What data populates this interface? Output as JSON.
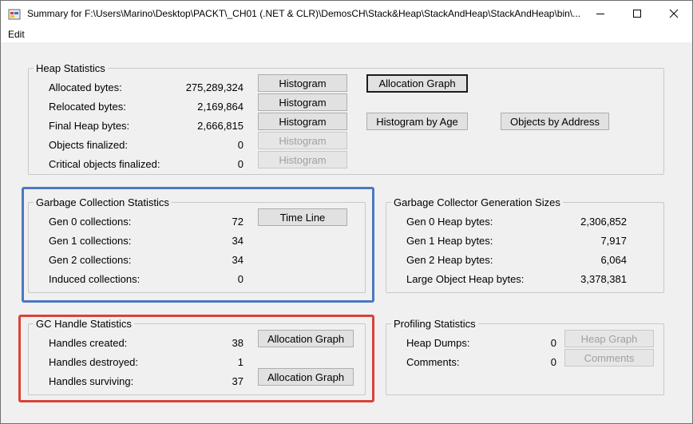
{
  "window": {
    "title": "Summary for F:\\Users\\Marino\\Desktop\\PACKT\\_CH01 (.NET & CLR)\\DemosCH\\Stack&Heap\\StackAndHeap\\StackAndHeap\\bin\\..."
  },
  "menu": {
    "items": [
      "Edit"
    ]
  },
  "heap_statistics": {
    "title": "Heap Statistics",
    "rows": [
      {
        "label": "Allocated bytes:",
        "value": "275,289,324",
        "button": "Histogram",
        "enabled": true
      },
      {
        "label": "Relocated bytes:",
        "value": "2,169,864",
        "button": "Histogram",
        "enabled": true
      },
      {
        "label": "Final Heap bytes:",
        "value": "2,666,815",
        "button": "Histogram",
        "enabled": true
      },
      {
        "label": "Objects finalized:",
        "value": "0",
        "button": "Histogram",
        "enabled": false
      },
      {
        "label": "Critical objects finalized:",
        "value": "0",
        "button": "Histogram",
        "enabled": false
      }
    ],
    "allocation_graph": "Allocation Graph",
    "histogram_by_age": "Histogram by Age",
    "objects_by_address": "Objects by Address"
  },
  "gc_statistics": {
    "title": "Garbage Collection Statistics",
    "rows": [
      {
        "label": "Gen 0 collections:",
        "value": "72"
      },
      {
        "label": "Gen 1 collections:",
        "value": "34"
      },
      {
        "label": "Gen 2 collections:",
        "value": "34"
      },
      {
        "label": "Induced collections:",
        "value": "0"
      }
    ],
    "time_line": "Time Line"
  },
  "generation_sizes": {
    "title": "Garbage Collector Generation Sizes",
    "rows": [
      {
        "label": "Gen 0 Heap bytes:",
        "value": "2,306,852"
      },
      {
        "label": "Gen 1 Heap bytes:",
        "value": "7,917"
      },
      {
        "label": "Gen 2 Heap bytes:",
        "value": "6,064"
      },
      {
        "label": "Large Object Heap bytes:",
        "value": "3,378,381"
      }
    ]
  },
  "gc_handles": {
    "title": "GC Handle Statistics",
    "rows": [
      {
        "label": "Handles created:",
        "value": "38"
      },
      {
        "label": "Handles destroyed:",
        "value": "1"
      },
      {
        "label": "Handles surviving:",
        "value": "37"
      }
    ],
    "allocation_graph_created": "Allocation Graph",
    "allocation_graph_surviving": "Allocation Graph"
  },
  "profiling": {
    "title": "Profiling Statistics",
    "rows": [
      {
        "label": "Heap Dumps:",
        "value": "0"
      },
      {
        "label": "Comments:",
        "value": "0"
      }
    ],
    "heap_graph": "Heap Graph",
    "comments_button": "Comments"
  },
  "colors": {
    "gc_highlight": "#4a78c2",
    "handles_highlight": "#d9423a"
  }
}
